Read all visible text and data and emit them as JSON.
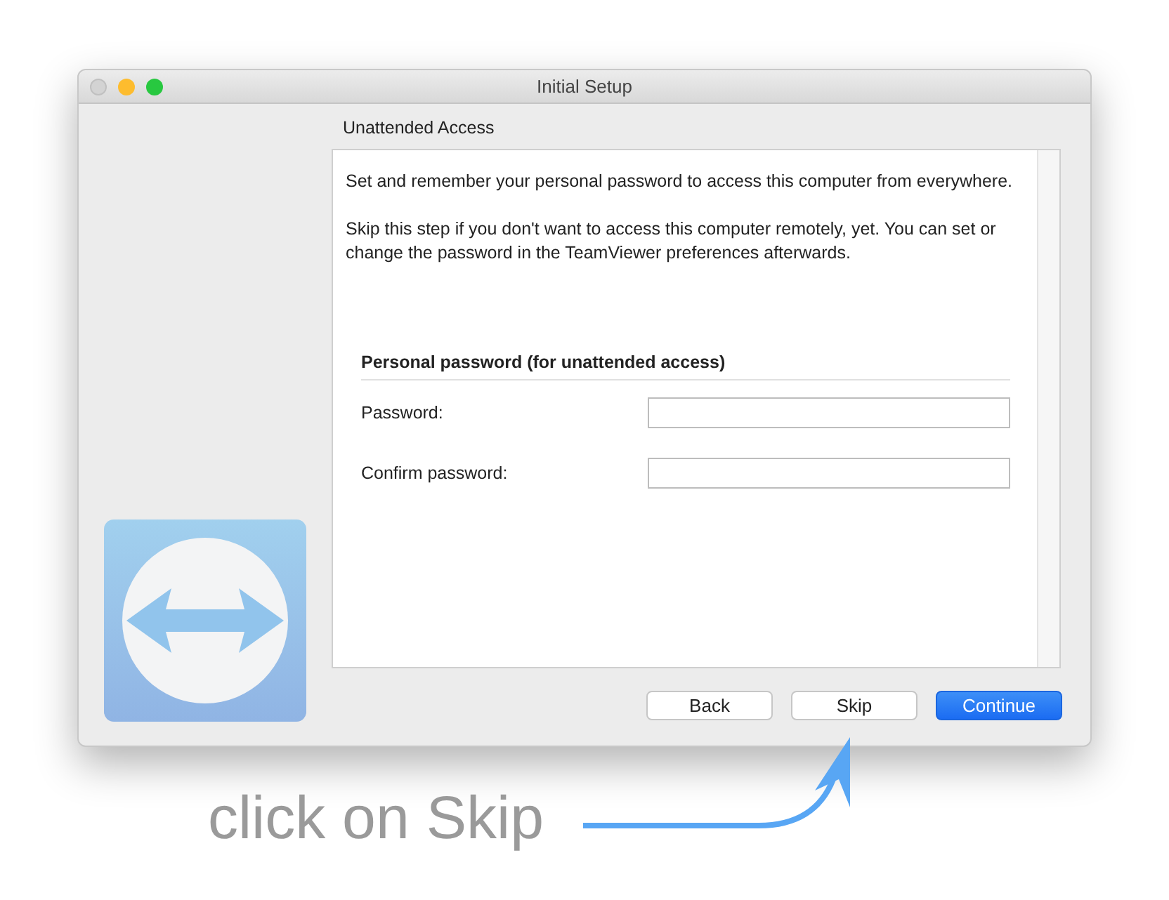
{
  "window": {
    "title": "Initial Setup"
  },
  "page": {
    "heading": "Unattended Access",
    "paragraphs": [
      "Set and remember your personal password to access this computer from everywhere.",
      "Skip this step if you don't want to access this computer remotely, yet. You can set or change the password in the TeamViewer preferences afterwards."
    ],
    "section_title": "Personal password (for unattended access)",
    "fields": [
      {
        "label": "Password:"
      },
      {
        "label": "Confirm password:"
      }
    ]
  },
  "buttons": [
    {
      "label": "Back",
      "kind": "default"
    },
    {
      "label": "Skip",
      "kind": "default"
    },
    {
      "label": "Continue",
      "kind": "primary"
    }
  ],
  "annotation": {
    "text": "click on Skip"
  }
}
